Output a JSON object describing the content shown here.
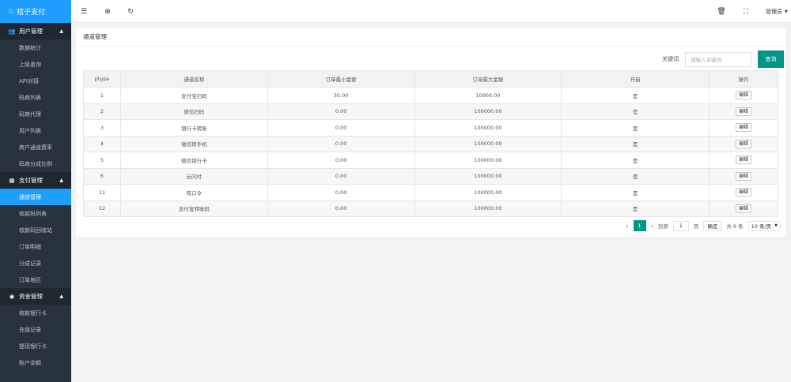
{
  "brand": {
    "name": "桔子支付"
  },
  "sidebar": {
    "groups": [
      {
        "title": "用户管理",
        "items": [
          "数据统计",
          "上级查询",
          "API对接",
          "码商列表",
          "码商代理",
          "用户列表",
          "商户通道费率",
          "码商分成比例"
        ]
      },
      {
        "title": "支付管理",
        "items": [
          "通道管理",
          "收款码列表",
          "收款码回收站",
          "订单明细",
          "分成记录",
          "订单地区"
        ]
      },
      {
        "title": "资金管理",
        "items": [
          "收款银行卡",
          "充值记录",
          "提现银行卡",
          "账户余额"
        ]
      }
    ],
    "active": "通道管理"
  },
  "topbar": {
    "user": "管理员"
  },
  "panel": {
    "title": "通道管理"
  },
  "search": {
    "label": "关键词",
    "placeholder": "请输入关键词",
    "button": "查询"
  },
  "table": {
    "headers": [
      "ptype",
      "通道名称",
      "订单最小金额",
      "订单最大金额",
      "开启",
      "操作"
    ],
    "rows": [
      [
        "1",
        "支付宝扫码",
        "30.00",
        "10000.00",
        "是",
        "编辑"
      ],
      [
        "2",
        "微信扫码",
        "0.00",
        "100000.00",
        "是",
        "编辑"
      ],
      [
        "3",
        "银行卡转账",
        "0.00",
        "100000.00",
        "是",
        "编辑"
      ],
      [
        "4",
        "微信转手机",
        "0.00",
        "100000.00",
        "是",
        "编辑"
      ],
      [
        "5",
        "微信银行卡",
        "0.00",
        "100000.00",
        "是",
        "编辑"
      ],
      [
        "6",
        "云闪付",
        "0.00",
        "100000.00",
        "是",
        "编辑"
      ],
      [
        "11",
        "吱口令",
        "0.00",
        "100000.00",
        "是",
        "编辑"
      ],
      [
        "12",
        "支付宝转账码",
        "0.00",
        "100000.00",
        "是",
        "编辑"
      ]
    ]
  },
  "pager": {
    "current": "1",
    "goto_label": "到第",
    "goto_value": "1",
    "page_unit": "页",
    "confirm": "确定",
    "total": "共 8 条",
    "page_size": "10 条/页"
  },
  "colors": {
    "sidebar_bg": "#28333e",
    "accent_blue": "#1e9fff",
    "accent_green": "#009688"
  }
}
